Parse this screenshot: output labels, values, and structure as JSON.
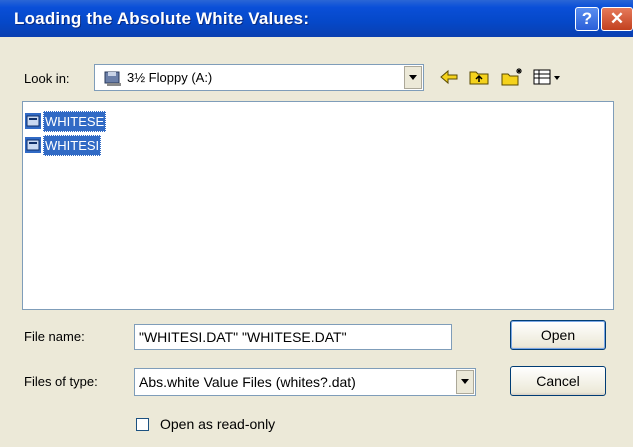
{
  "window": {
    "title": "Loading the Absolute White Values:",
    "help_glyph": "?",
    "close_glyph": "✕"
  },
  "lookin": {
    "label": "Look in:",
    "value": "3½ Floppy (A:)",
    "icon": "floppy-drive-icon"
  },
  "toolbar": {
    "icons": [
      "back-arrow-icon",
      "up-folder-icon",
      "new-folder-icon",
      "view-menu-icon"
    ]
  },
  "files": [
    {
      "name": "WHITESE",
      "icon": "data-file-icon",
      "selected": true
    },
    {
      "name": "WHITESI",
      "icon": "data-file-icon",
      "selected": true
    }
  ],
  "filename": {
    "label": "File name:",
    "value": "\"WHITESI.DAT\" \"WHITESE.DAT\""
  },
  "filetype": {
    "label": "Files of type:",
    "value": "Abs.white Value Files (whites?.dat)"
  },
  "readonly": {
    "label": "Open as read-only",
    "checked": false
  },
  "buttons": {
    "open": "Open",
    "cancel": "Cancel"
  },
  "colors": {
    "titlebar": "#0548c8",
    "selection": "#316ac5",
    "dialog": "#ece9d8"
  }
}
